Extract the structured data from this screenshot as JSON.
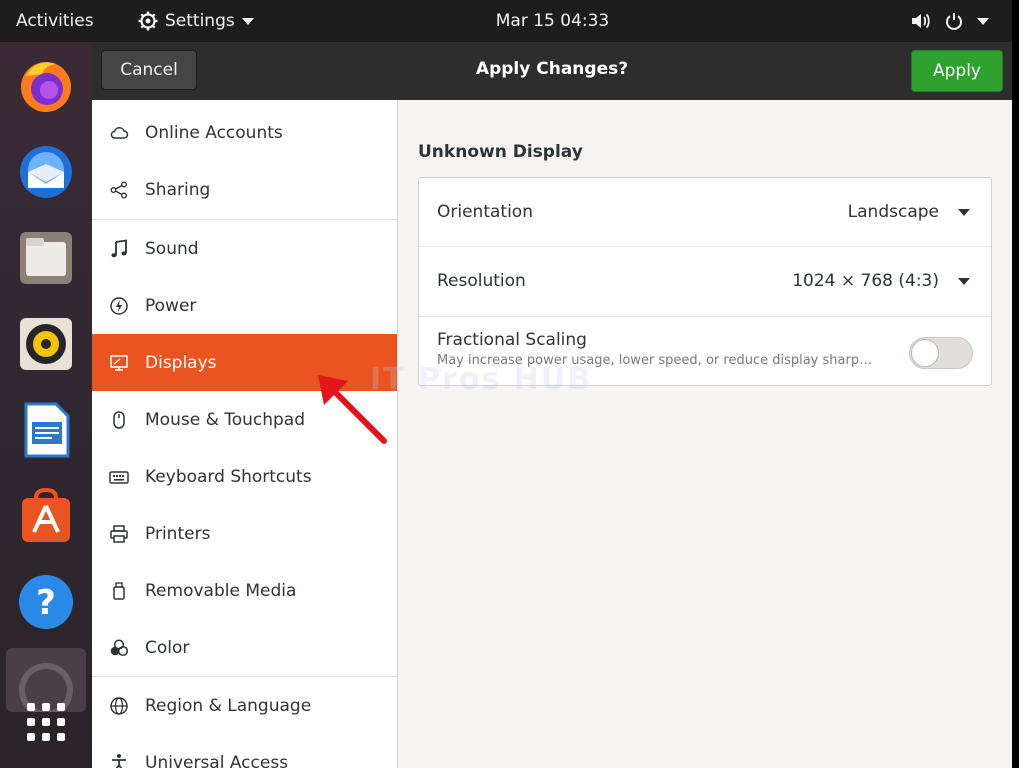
{
  "topbar": {
    "activities": "Activities",
    "app_menu": "Settings",
    "clock": "Mar 15  04:33"
  },
  "headerbar": {
    "cancel": "Cancel",
    "title": "Apply Changes?",
    "apply": "Apply"
  },
  "sidebar": {
    "items": [
      {
        "label": "Online Accounts",
        "icon": "cloud-icon"
      },
      {
        "label": "Sharing",
        "icon": "share-icon"
      },
      {
        "label": "Sound",
        "icon": "music-note-icon"
      },
      {
        "label": "Power",
        "icon": "power-icon"
      },
      {
        "label": "Displays",
        "icon": "display-icon",
        "active": true
      },
      {
        "label": "Mouse & Touchpad",
        "icon": "mouse-icon"
      },
      {
        "label": "Keyboard Shortcuts",
        "icon": "keyboard-icon"
      },
      {
        "label": "Printers",
        "icon": "printer-icon"
      },
      {
        "label": "Removable Media",
        "icon": "removable-media-icon"
      },
      {
        "label": "Color",
        "icon": "color-icon"
      },
      {
        "label": "Region & Language",
        "icon": "globe-icon"
      },
      {
        "label": "Universal Access",
        "icon": "accessibility-icon"
      }
    ]
  },
  "display": {
    "name": "Unknown Display",
    "orientation_label": "Orientation",
    "orientation_value": "Landscape",
    "resolution_label": "Resolution",
    "resolution_value": "1024 × 768 (4:3)",
    "fractional_label": "Fractional Scaling",
    "fractional_desc": "May increase power usage, lower speed, or reduce display sharp…",
    "fractional_enabled": false
  },
  "watermark": "IT Pros HUB",
  "colors": {
    "accent": "#e95420",
    "apply": "#2ea12e",
    "headerbar": "#2d2d2d",
    "arrow": "#e3141b"
  }
}
